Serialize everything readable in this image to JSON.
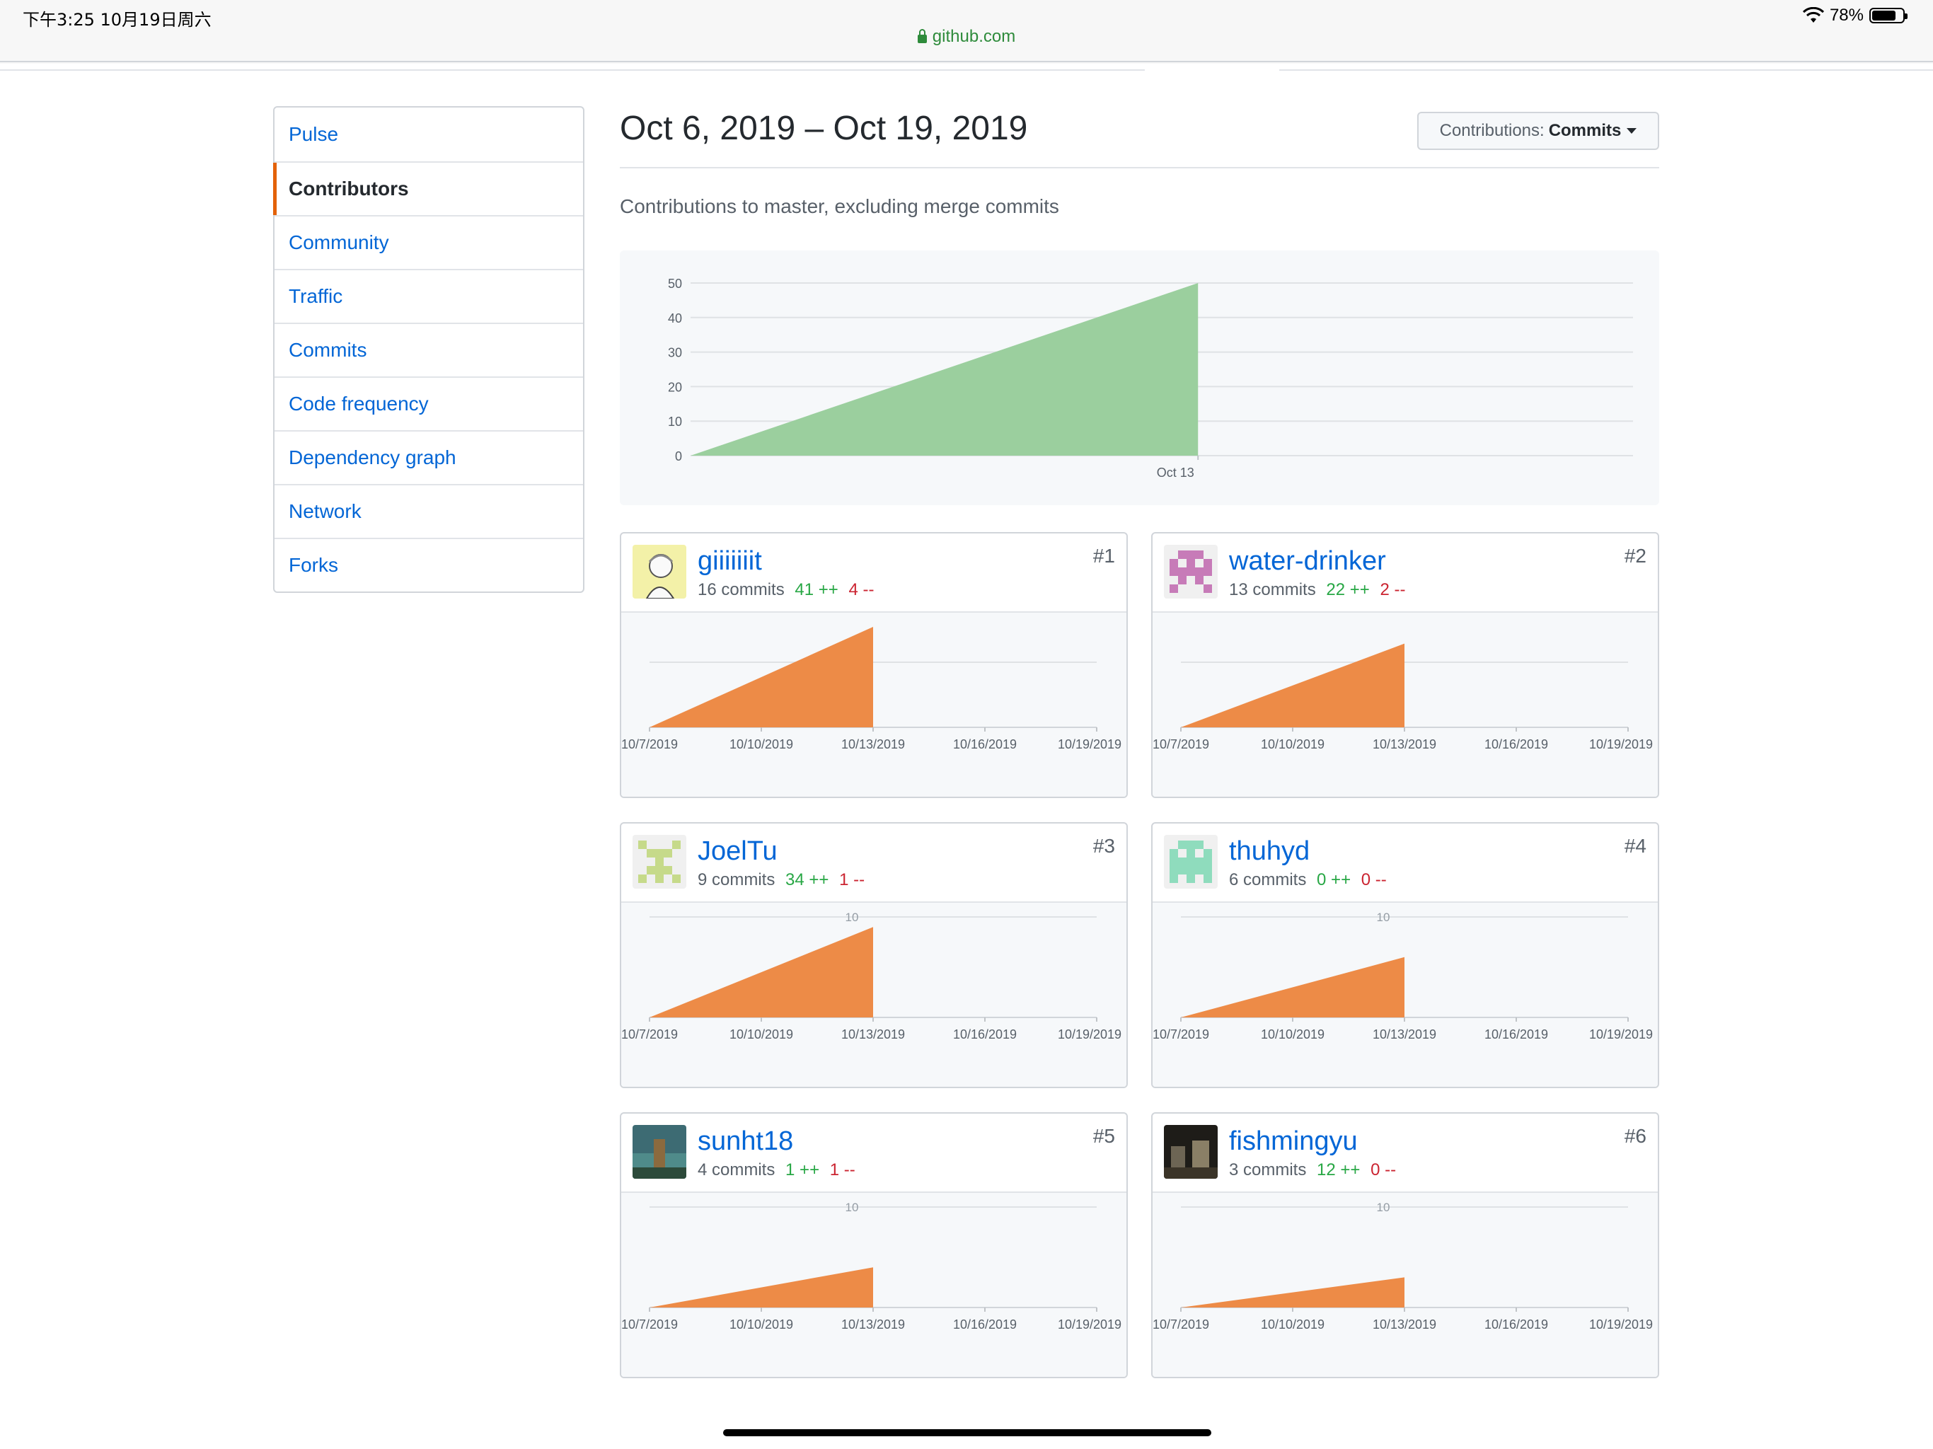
{
  "status_bar": {
    "time": "下午3:25   10月19日周六",
    "battery": "78%"
  },
  "browser": {
    "url": "github.com"
  },
  "sidebar": {
    "items": [
      {
        "label": "Pulse",
        "active": false
      },
      {
        "label": "Contributors",
        "active": true
      },
      {
        "label": "Community",
        "active": false
      },
      {
        "label": "Traffic",
        "active": false
      },
      {
        "label": "Commits",
        "active": false
      },
      {
        "label": "Code frequency",
        "active": false
      },
      {
        "label": "Dependency graph",
        "active": false
      },
      {
        "label": "Network",
        "active": false
      },
      {
        "label": "Forks",
        "active": false
      }
    ]
  },
  "header": {
    "date_range": "Oct 6, 2019 – Oct 19, 2019",
    "contributions_label": "Contributions:",
    "contributions_value": "Commits",
    "subtitle": "Contributions to master, excluding merge commits"
  },
  "colors": {
    "link": "#0366d6",
    "active_bar": "#e36209",
    "main_area": "#9bcf9e",
    "contrib_area": "#ed8b47",
    "additions": "#28a745",
    "deletions": "#cb2431"
  },
  "chart_data": [
    {
      "type": "area",
      "x": [
        "Oct 6",
        "Oct 13"
      ],
      "y": [
        0,
        50
      ],
      "x_tick_labels": [
        "Oct 13"
      ],
      "y_ticks": [
        0,
        10,
        20,
        30,
        40,
        50
      ],
      "ylim": [
        0,
        50
      ],
      "x_range": [
        "Oct 6",
        "Oct 19"
      ],
      "grid": true
    }
  ],
  "contributors": [
    {
      "rank": "#1",
      "username": "giiiiiiit",
      "commits": "16 commits",
      "additions": "41 ++",
      "deletions": "4 --",
      "avatar": "anime-avatar",
      "chart": {
        "type": "area",
        "x": [
          "10/7/2019",
          "10/13/2019"
        ],
        "y": [
          0,
          15
        ],
        "ylim": [
          0,
          15
        ],
        "x_tick_labels": [
          "10/7/2019",
          "10/10/2019",
          "10/13/2019",
          "10/16/2019",
          "10/19/2019"
        ],
        "y_tick_label": ""
      }
    },
    {
      "rank": "#2",
      "username": "water-drinker",
      "commits": "13 commits",
      "additions": "22 ++",
      "deletions": "2 --",
      "avatar": "identicon-pink",
      "chart": {
        "type": "area",
        "x": [
          "10/7/2019",
          "10/13/2019"
        ],
        "y": [
          0,
          12.5
        ],
        "ylim": [
          0,
          15
        ],
        "x_tick_labels": [
          "10/7/2019",
          "10/10/2019",
          "10/13/2019",
          "10/16/2019",
          "10/19/2019"
        ],
        "y_tick_label": ""
      }
    },
    {
      "rank": "#3",
      "username": "JoelTu",
      "commits": "9 commits",
      "additions": "34 ++",
      "deletions": "1 --",
      "avatar": "identicon-green",
      "chart": {
        "type": "area",
        "x": [
          "10/7/2019",
          "10/13/2019"
        ],
        "y": [
          0,
          9
        ],
        "ylim": [
          0,
          10
        ],
        "x_tick_labels": [
          "10/7/2019",
          "10/10/2019",
          "10/13/2019",
          "10/16/2019",
          "10/19/2019"
        ],
        "y_tick_label": "10"
      }
    },
    {
      "rank": "#4",
      "username": "thuhyd",
      "commits": "6 commits",
      "additions": "0 ++",
      "deletions": "0 --",
      "avatar": "identicon-teal",
      "chart": {
        "type": "area",
        "x": [
          "10/7/2019",
          "10/13/2019"
        ],
        "y": [
          0,
          6
        ],
        "ylim": [
          0,
          10
        ],
        "x_tick_labels": [
          "10/7/2019",
          "10/10/2019",
          "10/13/2019",
          "10/16/2019",
          "10/19/2019"
        ],
        "y_tick_label": "10"
      }
    },
    {
      "rank": "#5",
      "username": "sunht18",
      "commits": "4 commits",
      "additions": "1 ++",
      "deletions": "1 --",
      "avatar": "photo-landscape",
      "chart": {
        "type": "area",
        "x": [
          "10/7/2019",
          "10/13/2019"
        ],
        "y": [
          0,
          4
        ],
        "ylim": [
          0,
          10
        ],
        "x_tick_labels": [
          "10/7/2019",
          "10/10/2019",
          "10/13/2019",
          "10/16/2019",
          "10/19/2019"
        ],
        "y_tick_label": "10"
      }
    },
    {
      "rank": "#6",
      "username": "fishmingyu",
      "commits": "3 commits",
      "additions": "12 ++",
      "deletions": "0 --",
      "avatar": "photo-dark-scene",
      "chart": {
        "type": "area",
        "x": [
          "10/7/2019",
          "10/13/2019"
        ],
        "y": [
          0,
          3
        ],
        "ylim": [
          0,
          10
        ],
        "x_tick_labels": [
          "10/7/2019",
          "10/10/2019",
          "10/13/2019",
          "10/16/2019",
          "10/19/2019"
        ],
        "y_tick_label": "10"
      }
    }
  ]
}
